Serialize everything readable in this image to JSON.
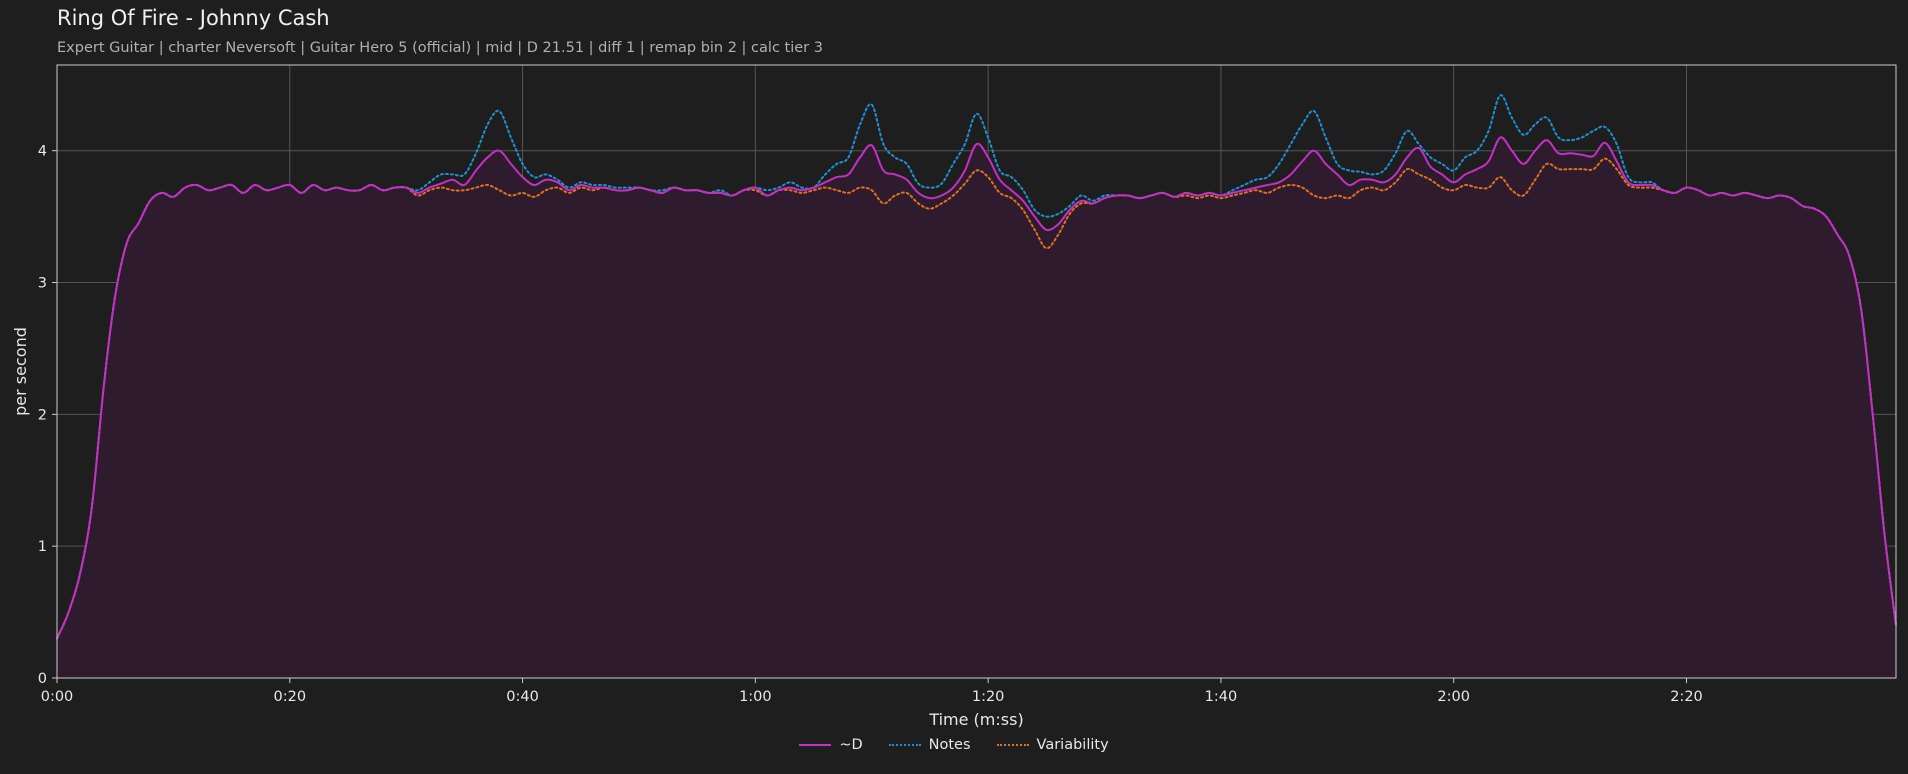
{
  "header": {
    "title": "Ring Of Fire - Johnny Cash",
    "subtitle": "Expert Guitar  |  charter Neversoft  |  Guitar Hero 5 (official)  |  mid  |  D 21.51  |  diff 1  |  remap bin 2  |  calc tier 3"
  },
  "colors": {
    "background": "#1e1e1e",
    "d_line": "#c42fc4",
    "notes_line": "#1f8fd4",
    "variability_line": "#e0701f",
    "fill": "#2e1c2e",
    "grid": "#555555"
  },
  "chart_data": {
    "type": "line",
    "title": "Ring Of Fire - Johnny Cash",
    "xlabel": "Time (m:ss)",
    "ylabel": "per second",
    "xlim": [
      0,
      158
    ],
    "ylim": [
      0,
      4.65
    ],
    "grid": true,
    "legend_position": "bottom-center",
    "x_ticks": [
      0,
      20,
      40,
      60,
      80,
      100,
      120,
      140
    ],
    "x_tick_labels": [
      "0:00",
      "0:20",
      "0:40",
      "1:00",
      "1:20",
      "1:40",
      "2:00",
      "2:20"
    ],
    "y_ticks": [
      0,
      1,
      2,
      3,
      4
    ],
    "y_tick_labels": [
      "0",
      "1",
      "2",
      "3",
      "4"
    ],
    "x": [
      0,
      1,
      2,
      3,
      4,
      5,
      6,
      7,
      8,
      9,
      10,
      11,
      12,
      13,
      14,
      15,
      16,
      17,
      18,
      19,
      20,
      21,
      22,
      23,
      24,
      25,
      26,
      27,
      28,
      29,
      30,
      31,
      32,
      33,
      34,
      35,
      36,
      37,
      38,
      39,
      40,
      41,
      42,
      43,
      44,
      45,
      46,
      47,
      48,
      49,
      50,
      51,
      52,
      53,
      54,
      55,
      56,
      57,
      58,
      59,
      60,
      61,
      62,
      63,
      64,
      65,
      66,
      67,
      68,
      69,
      70,
      71,
      72,
      73,
      74,
      75,
      76,
      77,
      78,
      79,
      80,
      81,
      82,
      83,
      84,
      85,
      86,
      87,
      88,
      89,
      90,
      91,
      92,
      93,
      94,
      95,
      96,
      97,
      98,
      99,
      100,
      101,
      102,
      103,
      104,
      105,
      106,
      107,
      108,
      109,
      110,
      111,
      112,
      113,
      114,
      115,
      116,
      117,
      118,
      119,
      120,
      121,
      122,
      123,
      124,
      125,
      126,
      127,
      128,
      129,
      130,
      131,
      132,
      133,
      134,
      135,
      136,
      137,
      138,
      139,
      140,
      141,
      142,
      143,
      144,
      145,
      146,
      147,
      148,
      149,
      150,
      151,
      152,
      153,
      154,
      155,
      156,
      157,
      158
    ],
    "series": [
      {
        "name": "~D",
        "style": "solid",
        "color": "#c42fc4",
        "values": [
          0.3,
          0.5,
          0.8,
          1.3,
          2.2,
          2.9,
          3.3,
          3.45,
          3.62,
          3.68,
          3.65,
          3.72,
          3.74,
          3.7,
          3.72,
          3.74,
          3.68,
          3.74,
          3.7,
          3.72,
          3.74,
          3.68,
          3.74,
          3.7,
          3.72,
          3.7,
          3.7,
          3.74,
          3.7,
          3.72,
          3.72,
          3.68,
          3.72,
          3.75,
          3.78,
          3.74,
          3.85,
          3.95,
          4.0,
          3.9,
          3.8,
          3.74,
          3.78,
          3.76,
          3.7,
          3.74,
          3.72,
          3.72,
          3.7,
          3.7,
          3.72,
          3.7,
          3.68,
          3.72,
          3.7,
          3.7,
          3.68,
          3.68,
          3.66,
          3.7,
          3.72,
          3.66,
          3.7,
          3.72,
          3.7,
          3.72,
          3.76,
          3.8,
          3.82,
          3.95,
          4.04,
          3.85,
          3.82,
          3.78,
          3.68,
          3.64,
          3.66,
          3.72,
          3.85,
          4.05,
          3.95,
          3.78,
          3.7,
          3.62,
          3.5,
          3.4,
          3.44,
          3.55,
          3.62,
          3.6,
          3.64,
          3.66,
          3.66,
          3.64,
          3.66,
          3.68,
          3.65,
          3.68,
          3.66,
          3.68,
          3.66,
          3.68,
          3.7,
          3.72,
          3.74,
          3.76,
          3.82,
          3.92,
          4.0,
          3.9,
          3.82,
          3.74,
          3.78,
          3.78,
          3.76,
          3.82,
          3.95,
          4.02,
          3.88,
          3.82,
          3.76,
          3.82,
          3.86,
          3.92,
          4.1,
          4.0,
          3.9,
          4.0,
          4.08,
          3.98,
          3.98,
          3.97,
          3.96,
          4.06,
          3.92,
          3.76,
          3.74,
          3.74,
          3.7,
          3.68,
          3.72,
          3.7,
          3.66,
          3.68,
          3.66,
          3.68,
          3.66,
          3.64,
          3.66,
          3.64,
          3.58,
          3.56,
          3.5,
          3.36,
          3.2,
          2.8,
          2.0,
          1.1,
          0.4
        ]
      },
      {
        "name": "Notes",
        "style": "dotted",
        "color": "#1f8fd4",
        "values": [
          0.3,
          0.5,
          0.8,
          1.3,
          2.2,
          2.9,
          3.3,
          3.45,
          3.62,
          3.68,
          3.65,
          3.72,
          3.74,
          3.7,
          3.72,
          3.74,
          3.68,
          3.74,
          3.7,
          3.72,
          3.74,
          3.68,
          3.74,
          3.7,
          3.72,
          3.7,
          3.7,
          3.74,
          3.7,
          3.72,
          3.72,
          3.7,
          3.76,
          3.82,
          3.82,
          3.82,
          3.98,
          4.2,
          4.3,
          4.1,
          3.9,
          3.8,
          3.82,
          3.78,
          3.72,
          3.76,
          3.74,
          3.74,
          3.72,
          3.72,
          3.72,
          3.7,
          3.7,
          3.72,
          3.7,
          3.7,
          3.68,
          3.7,
          3.66,
          3.7,
          3.72,
          3.7,
          3.72,
          3.76,
          3.72,
          3.72,
          3.82,
          3.9,
          3.95,
          4.2,
          4.35,
          4.05,
          3.95,
          3.9,
          3.75,
          3.72,
          3.75,
          3.9,
          4.05,
          4.28,
          4.1,
          3.85,
          3.8,
          3.7,
          3.55,
          3.5,
          3.52,
          3.58,
          3.66,
          3.62,
          3.66,
          3.66,
          3.66,
          3.64,
          3.66,
          3.68,
          3.65,
          3.68,
          3.66,
          3.68,
          3.66,
          3.7,
          3.74,
          3.78,
          3.8,
          3.9,
          4.05,
          4.2,
          4.3,
          4.1,
          3.9,
          3.85,
          3.84,
          3.82,
          3.85,
          3.98,
          4.15,
          4.05,
          3.95,
          3.9,
          3.85,
          3.95,
          4.0,
          4.15,
          4.42,
          4.25,
          4.12,
          4.2,
          4.25,
          4.1,
          4.08,
          4.1,
          4.15,
          4.18,
          4.05,
          3.8,
          3.76,
          3.76,
          3.7,
          3.68,
          3.72,
          3.7,
          3.66,
          3.68,
          3.66,
          3.68,
          3.66,
          3.64,
          3.66,
          3.64,
          3.58,
          3.56,
          3.5,
          3.36,
          3.2,
          2.8,
          2.0,
          1.1,
          0.4
        ]
      },
      {
        "name": "Variability",
        "style": "dotted",
        "color": "#e0701f",
        "values": [
          0.3,
          0.5,
          0.8,
          1.3,
          2.2,
          2.9,
          3.3,
          3.45,
          3.62,
          3.68,
          3.65,
          3.72,
          3.74,
          3.7,
          3.72,
          3.74,
          3.68,
          3.74,
          3.7,
          3.72,
          3.74,
          3.68,
          3.74,
          3.7,
          3.72,
          3.7,
          3.7,
          3.74,
          3.7,
          3.72,
          3.72,
          3.66,
          3.7,
          3.72,
          3.7,
          3.7,
          3.72,
          3.74,
          3.7,
          3.66,
          3.68,
          3.65,
          3.7,
          3.72,
          3.68,
          3.72,
          3.7,
          3.72,
          3.7,
          3.7,
          3.72,
          3.7,
          3.68,
          3.72,
          3.7,
          3.7,
          3.68,
          3.68,
          3.66,
          3.7,
          3.7,
          3.66,
          3.7,
          3.7,
          3.68,
          3.7,
          3.72,
          3.7,
          3.68,
          3.72,
          3.7,
          3.6,
          3.66,
          3.68,
          3.6,
          3.56,
          3.6,
          3.66,
          3.75,
          3.85,
          3.8,
          3.68,
          3.64,
          3.55,
          3.4,
          3.26,
          3.36,
          3.52,
          3.6,
          3.6,
          3.64,
          3.66,
          3.66,
          3.64,
          3.66,
          3.68,
          3.65,
          3.66,
          3.64,
          3.66,
          3.64,
          3.66,
          3.68,
          3.7,
          3.68,
          3.72,
          3.74,
          3.72,
          3.66,
          3.64,
          3.66,
          3.64,
          3.7,
          3.72,
          3.7,
          3.76,
          3.86,
          3.82,
          3.78,
          3.72,
          3.7,
          3.74,
          3.72,
          3.72,
          3.8,
          3.7,
          3.66,
          3.78,
          3.9,
          3.86,
          3.86,
          3.86,
          3.86,
          3.94,
          3.86,
          3.74,
          3.72,
          3.72,
          3.7,
          3.68,
          3.72,
          3.7,
          3.66,
          3.68,
          3.66,
          3.68,
          3.66,
          3.64,
          3.66,
          3.64,
          3.58,
          3.56,
          3.5,
          3.36,
          3.2,
          2.8,
          2.0,
          1.1,
          0.4
        ]
      }
    ]
  }
}
